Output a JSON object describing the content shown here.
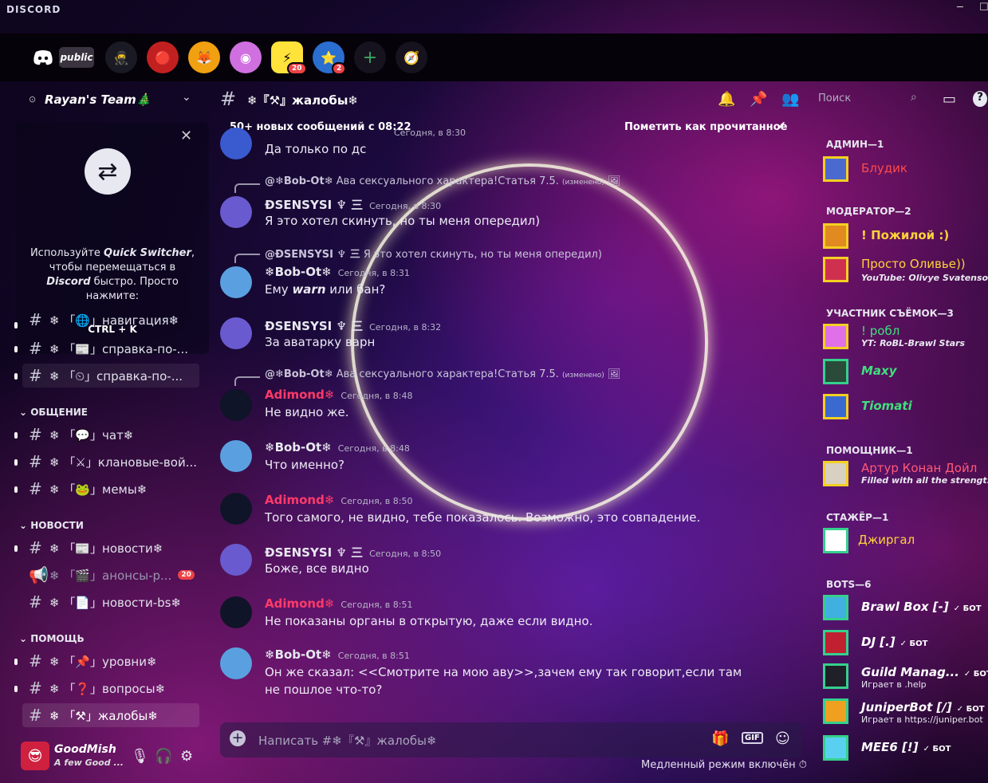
{
  "window": {
    "brand": "DISCORD"
  },
  "topbar": {
    "public_label": "public",
    "badge_yellow": "20",
    "badge_stars": "2",
    "add_icon": "plus-icon",
    "explore_icon": "compass-icon"
  },
  "sidebar": {
    "server_name": "Rayan's Team🎄",
    "quick_switcher": {
      "text_pre": "Используйте ",
      "text_bold": "Quick Switcher",
      "text_mid": ", чтобы перемещаться в ",
      "text_bold2": "Discord",
      "text_post": " быстро. Просто нажмите:",
      "shortcut": "CTRL + K"
    },
    "channels_top": [
      {
        "label": "❄ 「🌐」навигация❄"
      },
      {
        "label": "❄ 「📰」справка-по-..."
      },
      {
        "label": "❄ 「⏲」справка-по-..."
      }
    ],
    "categories": {
      "general": "ОБЩЕНИЕ",
      "news": "НОВОСТИ",
      "help": "ПОМОЩЬ"
    },
    "general_channels": [
      {
        "label": "❄ 「💬」чат❄"
      },
      {
        "label": "❄ 「⚔」клановые-вой..."
      },
      {
        "label": "❄ 「🐸」мемы❄"
      }
    ],
    "news_channels": [
      {
        "label": "❄ 「📰」новости❄"
      },
      {
        "label": "❄ 「🎬」анонсы-р...",
        "badge": "20"
      },
      {
        "label": "❄ 「📄」новости-bs❄"
      }
    ],
    "help_channels": [
      {
        "label": "❄ 「📌」уровни❄"
      },
      {
        "label": "❄ 「❓」вопросы❄"
      },
      {
        "label": "❄ 「⚒」жалобы❄"
      }
    ],
    "user": {
      "name": "GoodMish",
      "status": "A few Good ..."
    }
  },
  "chat": {
    "channel_title": "❄『⚒』жалобы❄",
    "new_messages": "50+ новых сообщений с 08:22",
    "mark_read": "Пометить как прочитанное",
    "messages": [
      {
        "author": "",
        "time": "Сегодня, в 8:30",
        "text": "Да только по дс"
      },
      {
        "reply_author": "@❄Bob-Ot❄",
        "reply_text": "Ава сексуального характера!Статья 7.5.",
        "reply_edited": "(изменено)",
        "author": "ĐSENSYSI ♆ 三",
        "time": "Сегодня, в 8:30",
        "text": "Я это хотел скинуть, но ты меня опередил)"
      },
      {
        "reply_author": "@ĐSENSYSI ♆ 三",
        "reply_text": "Я это хотел скинуть, но ты меня опередил)",
        "author": "❄Bob-Ot❄",
        "time": "Сегодня, в 8:31",
        "text_pre": "Ему ",
        "text_bold": "warn",
        "text_post": " или бан?"
      },
      {
        "author": "ĐSENSYSI ♆ 三",
        "time": "Сегодня, в 8:32",
        "text": "За аватарку варн"
      },
      {
        "reply_author": "@❄Bob-Ot❄",
        "reply_text": "Ава сексуального характера!Статья 7.5.",
        "reply_edited": "(изменено)",
        "author": "Adimond❄",
        "time": "Сегодня, в 8:48",
        "text": "Не видно же."
      },
      {
        "author": "❄Bob-Ot❄",
        "time": "Сегодня, в 8:48",
        "text": "Что именно?"
      },
      {
        "author": "Adimond❄",
        "time": "Сегодня, в 8:50",
        "text": "Того самого, не видно, тебе показалось. Возможно, это совпадение."
      },
      {
        "author": "ĐSENSYSI ♆ 三",
        "time": "Сегодня, в 8:50",
        "text": "Боже, все видно"
      },
      {
        "author": "Adimond❄",
        "time": "Сегодня, в 8:51",
        "text": "Не показаны органы в открытую, даже если видно."
      },
      {
        "author": "❄Bob-Ot❄",
        "time": "Сегодня, в 8:51",
        "text": "Он же сказал: <<Смотрите на мою аву>>,зачем ему так говорит,если там не пошлое что-то?"
      }
    ],
    "input_placeholder": "Написать #❄『⚒』жалобы❄",
    "slowmode": "Медленный режим включён"
  },
  "members": {
    "search_placeholder": "Поиск",
    "groups": [
      {
        "title": "АДМИН—1",
        "items": [
          {
            "name": "Блудик",
            "color": "#ff4a4a"
          }
        ]
      },
      {
        "title": "МОДЕРАТОР—2",
        "items": [
          {
            "name": "! Пожилой :)",
            "color": "#ffd23a"
          },
          {
            "name": "Просто Оливье))",
            "color": "#ffd23a",
            "sub": "YouTube: Olivye Svatenson"
          }
        ]
      },
      {
        "title": "УЧАСТНИК СЪЁМОК—3",
        "items": [
          {
            "name": "! робл",
            "color": "#3ee07a",
            "sub": "YT: RoBL-Brawl Stars"
          },
          {
            "name": "Maxy",
            "color": "#3ee07a"
          },
          {
            "name": "Tiomati",
            "color": "#3ee07a"
          }
        ]
      },
      {
        "title": "ПОМОЩНИК—1",
        "items": [
          {
            "name": "Артур Конан Дойл",
            "color": "#ff5a7a",
            "sub": "Filled with all the strengt..."
          }
        ]
      },
      {
        "title": "СТАЖЁР—1",
        "items": [
          {
            "name": "Джиргал",
            "color": "#ffd23a"
          }
        ]
      },
      {
        "title": "BOTS—6",
        "items": [
          {
            "name": "Brawl Box [-]",
            "color": "#ffffff",
            "tag": "✓ БОТ"
          },
          {
            "name": "DJ [.]",
            "color": "#ffffff",
            "tag": "✓ БОТ"
          },
          {
            "name": "Guild Manag...",
            "color": "#ffffff",
            "tag": "✓ БОТ",
            "sub": "Играет в .help"
          },
          {
            "name": "JuniperBot [/]",
            "color": "#ffffff",
            "tag": "✓ БОТ",
            "sub": "Играет в https://juniper.bot"
          },
          {
            "name": "MEE6 [!]",
            "color": "#ffffff",
            "tag": "✓ БОТ"
          }
        ]
      }
    ]
  }
}
